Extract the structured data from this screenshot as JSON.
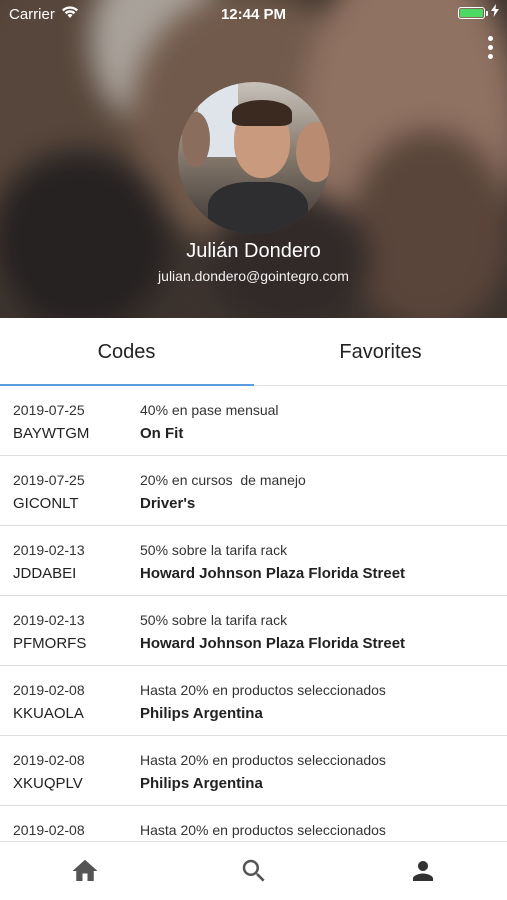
{
  "status_bar": {
    "carrier": "Carrier",
    "time": "12:44 PM",
    "battery_level": 1.0,
    "icons": [
      "wifi-icon",
      "battery-icon",
      "charging-bolt-icon"
    ]
  },
  "profile": {
    "name": "Julián Dondero",
    "email": "julian.dondero@gointegro.com",
    "menu_icon": "more-vertical-icon"
  },
  "tabs": [
    {
      "label": "Codes",
      "selected": true
    },
    {
      "label": "Favorites",
      "selected": false
    }
  ],
  "colors": {
    "tab_indicator": "#5b9be0",
    "battery": "#4cd964",
    "nav_icon": "#555555"
  },
  "codes": [
    {
      "date": "2019-07-25",
      "code": "BAYWTGM",
      "description": "40% en pase mensual",
      "merchant": "On Fit"
    },
    {
      "date": "2019-07-25",
      "code": "GICONLT",
      "description": "20% en cursos  de manejo",
      "merchant": "Driver's"
    },
    {
      "date": "2019-02-13",
      "code": "JDDABEI",
      "description": "50% sobre la tarifa rack",
      "merchant": "Howard Johnson Plaza Florida Street"
    },
    {
      "date": "2019-02-13",
      "code": "PFMORFS",
      "description": "50% sobre la tarifa rack",
      "merchant": "Howard Johnson Plaza Florida Street"
    },
    {
      "date": "2019-02-08",
      "code": "KKUAOLA",
      "description": "Hasta 20% en productos seleccionados",
      "merchant": "Philips Argentina"
    },
    {
      "date": "2019-02-08",
      "code": "XKUQPLV",
      "description": "Hasta 20% en productos seleccionados",
      "merchant": "Philips Argentina"
    },
    {
      "date": "2019-02-08",
      "code": "",
      "description": "Hasta 20% en productos seleccionados",
      "merchant": ""
    }
  ],
  "bottom_nav": [
    {
      "icon": "home-icon"
    },
    {
      "icon": "search-icon"
    },
    {
      "icon": "profile-icon",
      "selected": true
    }
  ]
}
